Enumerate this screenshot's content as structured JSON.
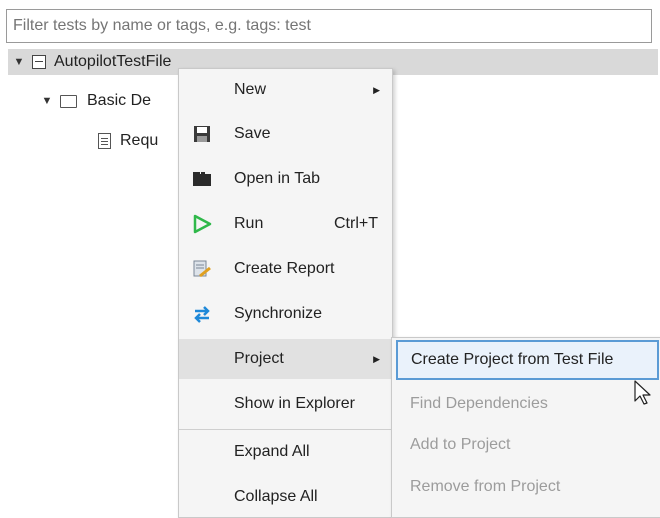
{
  "filter": {
    "placeholder": "Filter tests by name or tags, e.g. tags: test"
  },
  "tree": {
    "root_label": "AutopilotTestFile",
    "child_label": "Basic De",
    "leaf_label": "Requ"
  },
  "context_menu": {
    "new_label": "New",
    "save_label": "Save",
    "open_in_tab_label": "Open in Tab",
    "run_label": "Run",
    "run_shortcut": "Ctrl+T",
    "create_report_label": "Create Report",
    "synchronize_label": "Synchronize",
    "project_label": "Project",
    "show_in_explorer_label": "Show in Explorer",
    "expand_all_label": "Expand All",
    "collapse_all_label": "Collapse All"
  },
  "project_submenu": {
    "create_project_label": "Create Project from Test File",
    "find_dependencies_label": "Find Dependencies",
    "add_to_project_label": "Add to Project",
    "remove_from_project_label": "Remove from Project"
  },
  "icons": {
    "run": "play-icon",
    "save": "floppy-disk-icon",
    "open_in_tab": "tab-icon",
    "create_report": "report-icon",
    "synchronize": "sync-arrows-icon"
  },
  "colors": {
    "run_green": "#2fb84a",
    "sync_blue": "#1e88d8",
    "active_border": "#5b9bd5"
  }
}
